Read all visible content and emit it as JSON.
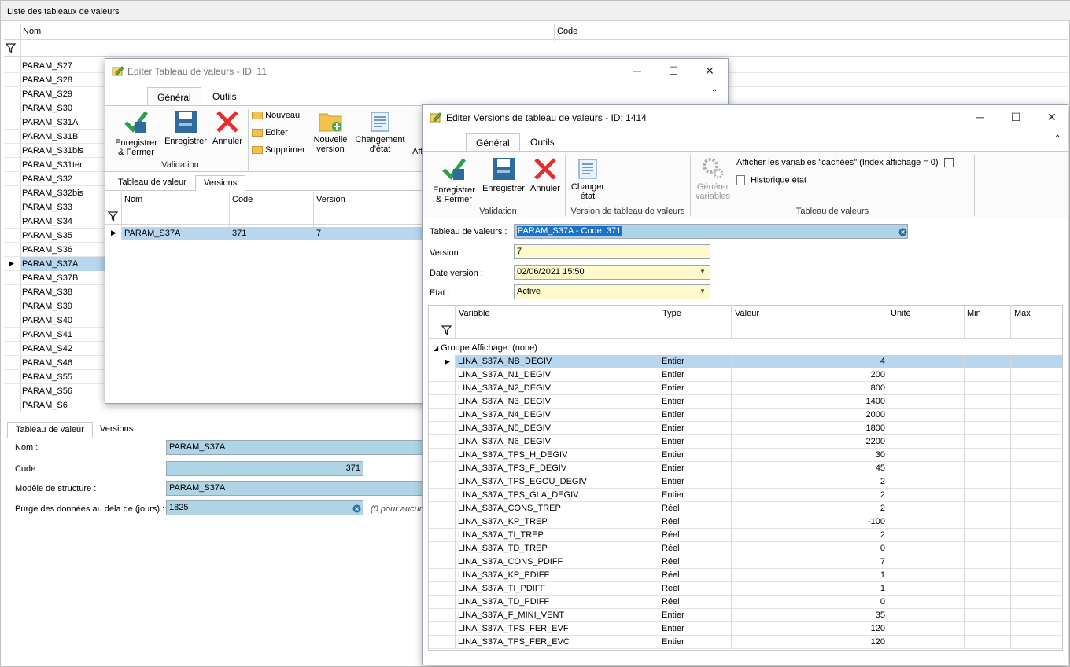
{
  "main": {
    "title": "Liste des tableaux de valeurs",
    "columns": [
      "Nom",
      "Code"
    ],
    "rows": [
      "PARAM_S27",
      "PARAM_S28",
      "PARAM_S29",
      "PARAM_S30",
      "PARAM_S31A",
      "PARAM_S31B",
      "PARAM_S31bis",
      "PARAM_S31ter",
      "PARAM_S32",
      "PARAM_S32bis",
      "PARAM_S33",
      "PARAM_S34",
      "PARAM_S35",
      "PARAM_S36",
      "PARAM_S37A",
      "PARAM_S37B",
      "PARAM_S38",
      "PARAM_S39",
      "PARAM_S40",
      "PARAM_S41",
      "PARAM_S42",
      "PARAM_S46",
      "PARAM_S55",
      "PARAM_S56",
      "PARAM_S6"
    ],
    "selected_row": "PARAM_S37A",
    "detail_tabs": [
      "Tableau de valeur",
      "Versions"
    ],
    "labels": {
      "nom": "Nom :",
      "code": "Code :",
      "modele": "Modèle de structure :",
      "purge": "Purge des données au dela de (jours) :"
    },
    "values": {
      "nom": "PARAM_S37A",
      "code": "371",
      "modele": "PARAM_S37A",
      "purge": "1825",
      "purge_note": "(0 pour aucun"
    }
  },
  "win1": {
    "title": "Editer Tableau de valeurs - ID: 11",
    "tabs": [
      "Général",
      "Outils"
    ],
    "buttons": {
      "save_close": "Enregistrer & Fermer",
      "save": "Enregistrer",
      "cancel": "Annuler",
      "nouveau": "Nouveau",
      "editer": "Editer",
      "supprimer": "Supprimer",
      "new_version": "Nouvelle version",
      "change_state": "Changement d'état",
      "aff": "Aff"
    },
    "group_validation": "Validation",
    "sub_tabs": [
      "Tableau de valeur",
      "Versions"
    ],
    "columns": [
      "Nom",
      "Code",
      "Version"
    ],
    "row": {
      "nom": "PARAM_S37A",
      "code": "371",
      "version": "7"
    }
  },
  "win2": {
    "title": "Editer Versions de tableau de valeurs - ID: 1414",
    "tabs": [
      "Général",
      "Outils"
    ],
    "buttons": {
      "save_close": "Enregistrer & Fermer",
      "save": "Enregistrer",
      "cancel": "Annuler",
      "change_state": "Changer état",
      "generate": "Générer variables",
      "show_hidden": "Afficher les variables \"cachées\" (Index affichage = 0)",
      "history": "Historique état"
    },
    "groups": {
      "validation": "Validation",
      "version": "Version de tableau de valeurs",
      "tableau": "Tableau de valeurs"
    },
    "form": {
      "tableau_label": "Tableau de valeurs :",
      "tableau_value": "PARAM_S37A - Code: 371",
      "version_label": "Version :",
      "version_value": "7",
      "date_label": "Date version :",
      "date_value": "02/06/2021 15:50",
      "etat_label": "Etat :",
      "etat_value": "Active"
    },
    "columns": [
      "Variable",
      "Type",
      "Valeur",
      "Unité",
      "Min",
      "Max"
    ],
    "group_row": "Groupe Affichage:  (none)",
    "rows": [
      [
        "LINA_S37A_NB_DEGIV",
        "Entier",
        "4"
      ],
      [
        "LINA_S37A_N1_DEGIV",
        "Entier",
        "200"
      ],
      [
        "LINA_S37A_N2_DEGIV",
        "Entier",
        "800"
      ],
      [
        "LINA_S37A_N3_DEGIV",
        "Entier",
        "1400"
      ],
      [
        "LINA_S37A_N4_DEGIV",
        "Entier",
        "2000"
      ],
      [
        "LINA_S37A_N5_DEGIV",
        "Entier",
        "1800"
      ],
      [
        "LINA_S37A_N6_DEGIV",
        "Entier",
        "2200"
      ],
      [
        "LINA_S37A_TPS_H_DEGIV",
        "Entier",
        "30"
      ],
      [
        "LINA_S37A_TPS_F_DEGIV",
        "Entier",
        "45"
      ],
      [
        "LINA_S37A_TPS_EGOU_DEGIV",
        "Entier",
        "2"
      ],
      [
        "LINA_S37A_TPS_GLA_DEGIV",
        "Entier",
        "2"
      ],
      [
        "LINA_S37A_CONS_TREP",
        "Réel",
        "2"
      ],
      [
        "LINA_S37A_KP_TREP",
        "Réel",
        "-100"
      ],
      [
        "LINA_S37A_TI_TREP",
        "Réel",
        "2"
      ],
      [
        "LINA_S37A_TD_TREP",
        "Réel",
        "0"
      ],
      [
        "LINA_S37A_CONS_PDIFF",
        "Réel",
        "7"
      ],
      [
        "LINA_S37A_KP_PDIFF",
        "Réel",
        "1"
      ],
      [
        "LINA_S37A_TI_PDIFF",
        "Réel",
        "1"
      ],
      [
        "LINA_S37A_TD_PDIFF",
        "Réel",
        "0"
      ],
      [
        "LINA_S37A_F_MINI_VENT",
        "Entier",
        "35"
      ],
      [
        "LINA_S37A_TPS_FER_EVF",
        "Entier",
        "120"
      ],
      [
        "LINA_S37A_TPS_FER_EVC",
        "Entier",
        "120"
      ]
    ]
  }
}
